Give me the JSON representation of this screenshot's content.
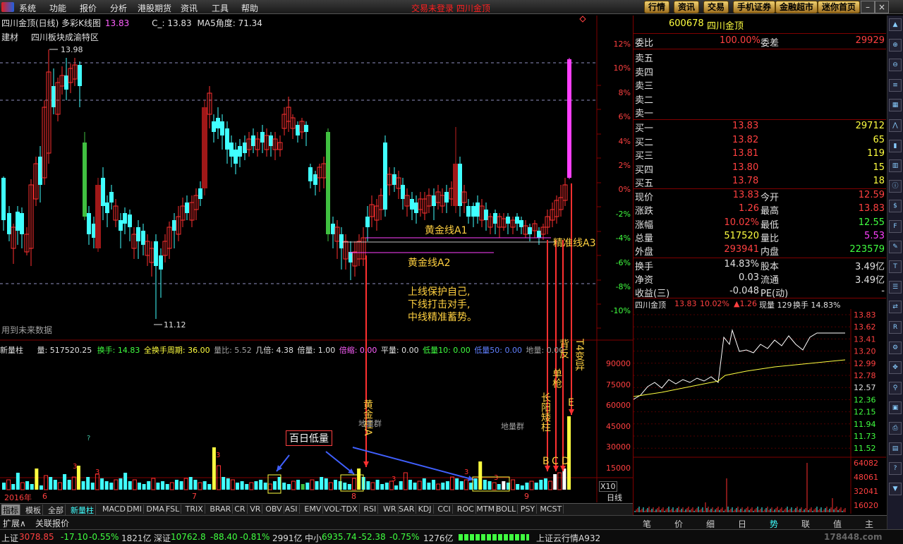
{
  "menu": {
    "items": [
      "系统",
      "功能",
      "报价",
      "分析",
      "港股期货",
      "资讯",
      "工具",
      "帮助"
    ],
    "center_title": "交易未登录  四川金顶",
    "top_buttons": [
      "行情",
      "资讯",
      "交易",
      "手机证券",
      "金融超市",
      "迷你首页"
    ]
  },
  "chart_header": {
    "title": "四川金顶(日线) 多彩K线图",
    "title_value": "13.83",
    "c_label": "C_: 13.83",
    "ma5_label": "MA5角度: 71.34",
    "line2_sector": "建材",
    "line2_region": "四川板块成渝特区",
    "high_label": "13.98",
    "low_label": "11.12",
    "future_data": "用到未来数据"
  },
  "pct_axis": [
    "12%",
    "10%",
    "8%",
    "6%",
    "4%",
    "2%",
    "0%",
    "-2%",
    "-4%",
    "-6%",
    "-8%",
    "-10%"
  ],
  "vol_axis": [
    "90000",
    "75000",
    "60000",
    "45000",
    "30000",
    "15000"
  ],
  "vol_unit": "X10",
  "annotations": {
    "gold_a1": "黄金线A1",
    "gold_a2": "黄金线A2",
    "precise_a3": "精准线A3",
    "motto": [
      "上线保护自己,",
      "下线打击对手,",
      "中线精准蓄势。"
    ],
    "gold_pillar": "黄金柱A",
    "long_yang": "长阳矮柱",
    "single_gun": "单枪",
    "back_reverse": "背反",
    "t4": "T4变异",
    "b_label": "B",
    "c_label": "C",
    "d_label": "D",
    "e_label": "E",
    "hundred_day_low": "百日低量",
    "ground_group1": "地量群",
    "ground_group2": "地量群"
  },
  "date_axis": {
    "year": "2016年",
    "months": [
      "6",
      "7",
      "8",
      "9"
    ],
    "period": "日线"
  },
  "volume_header": {
    "name": "新量柱",
    "vol": "量: 517520.25",
    "turnover": "换手: 14.83",
    "full_turn": "全换手周期: 36.00",
    "vol_ratio": "量比: 5.52",
    "ji_bei": "几倍: 4.38",
    "bei_liang": "倍量: 1.00",
    "bei_suo": "倍缩: 0.00",
    "ping_liang": "平量: 0.00",
    "di_liang10": "低量10: 0.00",
    "di_liang50": "低量50: 0.00",
    "di_liang": "地量: 0.00"
  },
  "indicator_tabs": [
    "指标",
    "模板",
    "全部",
    "新量柱",
    "MACD",
    "DMI",
    "DMA",
    "FSL",
    "TRIX",
    "BRAR",
    "CR",
    "VR",
    "OBV",
    "ASI",
    "EMV",
    "VOL-TDX",
    "RSI",
    "WR",
    "SAR",
    "KDJ",
    "CCI",
    "ROC",
    "MTM",
    "BOLL",
    "PSY",
    "MCST"
  ],
  "extra_tabs": [
    "扩展∧",
    "关联报价"
  ],
  "quote": {
    "code": "600678",
    "name": "四川金顶",
    "wei_bi_label": "委比",
    "wei_bi": "100.00%",
    "wei_cha_label": "委差",
    "wei_cha": "29929",
    "sells": [
      {
        "label": "卖五",
        "price": "",
        "vol": ""
      },
      {
        "label": "卖四",
        "price": "",
        "vol": ""
      },
      {
        "label": "卖三",
        "price": "",
        "vol": ""
      },
      {
        "label": "卖二",
        "price": "",
        "vol": ""
      },
      {
        "label": "卖一",
        "price": "",
        "vol": ""
      }
    ],
    "buys": [
      {
        "label": "买一",
        "price": "13.83",
        "vol": "29712"
      },
      {
        "label": "买二",
        "price": "13.82",
        "vol": "65"
      },
      {
        "label": "买三",
        "price": "13.81",
        "vol": "119"
      },
      {
        "label": "买四",
        "price": "13.80",
        "vol": "15"
      },
      {
        "label": "买五",
        "price": "13.78",
        "vol": "18"
      }
    ],
    "stats": [
      {
        "l1": "现价",
        "v1": "13.83",
        "l2": "今开",
        "v2": "12.59"
      },
      {
        "l1": "涨跌",
        "v1": "1.26",
        "l2": "最高",
        "v2": "13.83"
      },
      {
        "l1": "涨幅",
        "v1": "10.02%",
        "l2": "最低",
        "v2": "12.55"
      },
      {
        "l1": "总量",
        "v1": "517520",
        "l2": "量比",
        "v2": "5.53"
      },
      {
        "l1": "外盘",
        "v1": "293941",
        "l2": "内盘",
        "v2": "223579"
      }
    ],
    "fund": [
      {
        "l1": "换手",
        "v1": "14.83%",
        "l2": "股本",
        "v2": "3.49亿"
      },
      {
        "l1": "净资",
        "v1": "0.03",
        "l2": "流通",
        "v2": "3.49亿"
      },
      {
        "l1": "收益(三)",
        "v1": "-0.048",
        "l2": "PE(动)",
        "v2": "-"
      }
    ]
  },
  "mini_chart": {
    "name": "四川金顶",
    "price": "13.83",
    "pct": "10.02%",
    "change": "▲1.26",
    "now_vol": "现量 129",
    "turnover": "换手 14.83%",
    "price_axis": [
      "13.83",
      "13.62",
      "13.41",
      "13.20",
      "12.99",
      "12.78",
      "12.57",
      "12.36",
      "12.15",
      "11.94",
      "11.73",
      "11.52"
    ],
    "vol_axis": [
      "64082",
      "48061",
      "32041",
      "16020"
    ]
  },
  "bottom_tabs": [
    "笔",
    "价",
    "细",
    "日",
    "势",
    "联",
    "值",
    "主"
  ],
  "status": {
    "sh_label": "上证",
    "sh_value": "3078.85",
    "sh_chg": "-17.10",
    "sh_pct": "-0.55%",
    "sh_amt": "1821亿",
    "sz_label": "深证",
    "sz_value": "10762.8",
    "sz_chg": "-88.40",
    "sz_pct": "-0.81%",
    "sz_amt": "2991亿",
    "zx_label": "中小",
    "zx_value": "6935.74",
    "zx_chg": "-52.38",
    "zx_pct": "-0.75%",
    "zx_amt": "1276亿",
    "cloud": "上证云行情A932",
    "watermark": "178448.com"
  },
  "colors": {
    "up": "#ff3030",
    "down": "#40ffff",
    "magenta": "#ff40ff",
    "green": "#40c040",
    "yellow": "#ffff40",
    "gold": "#ffd040",
    "blue": "#4060ff"
  }
}
